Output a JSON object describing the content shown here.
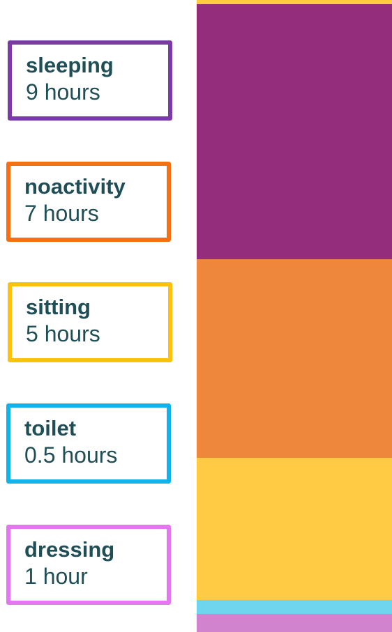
{
  "colors": {
    "text": "#1f4e57"
  },
  "legend": [
    {
      "name": "sleeping",
      "duration": "9 hours",
      "border_color": "#7b3ba7"
    },
    {
      "name": "noactivity",
      "duration": "7 hours",
      "border_color": "#f7700f"
    },
    {
      "name": "sitting",
      "duration": "5 hours",
      "border_color": "#ffc20c"
    },
    {
      "name": "toilet",
      "duration": "0.5 hours",
      "border_color": "#12b3ec"
    },
    {
      "name": "dressing",
      "duration": "1 hour",
      "border_color": "#e477ef"
    }
  ],
  "chart_data": {
    "type": "bar",
    "stacked": true,
    "orientation": "vertical",
    "categories": [
      ""
    ],
    "series": [
      {
        "name": "sleeping",
        "values": [
          9
        ],
        "color": "#932d7c"
      },
      {
        "name": "noactivity",
        "values": [
          7
        ],
        "color": "#ee873c"
      },
      {
        "name": "sitting",
        "values": [
          5
        ],
        "color": "#ffcb45"
      },
      {
        "name": "toilet",
        "values": [
          0.5
        ],
        "color": "#6fd5ee"
      },
      {
        "name": "dressing",
        "values": [
          1
        ],
        "color": "#d183cd"
      }
    ],
    "top_segment_color": "#ffcb45",
    "title": "",
    "xlabel": "",
    "ylabel": "",
    "axes_visible": false,
    "grid": false
  }
}
